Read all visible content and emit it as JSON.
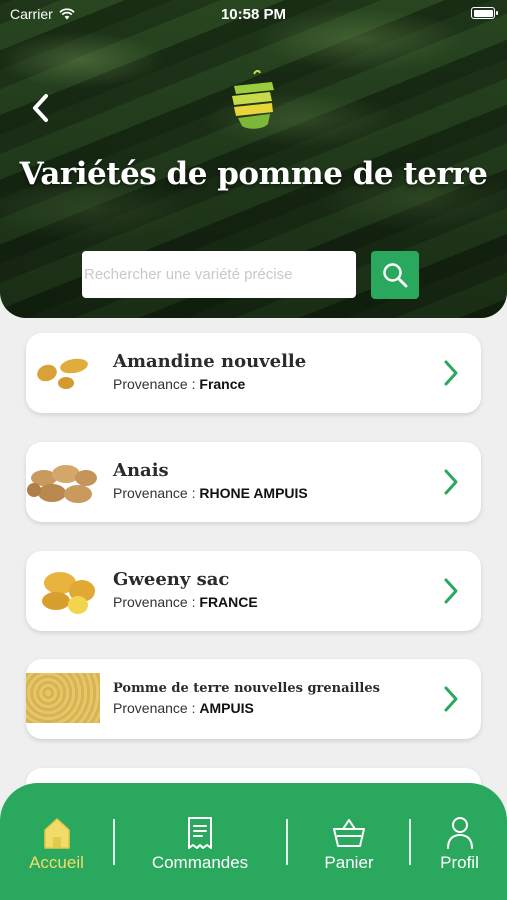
{
  "status_bar": {
    "carrier": "Carrier",
    "time": "10:58 PM"
  },
  "header": {
    "title": "Variétés de pomme de terre"
  },
  "search": {
    "placeholder": "Rechercher une variété précise"
  },
  "origin_label": "Provenance :",
  "items": [
    {
      "name": "Amandine nouvelle",
      "origin": "France"
    },
    {
      "name": "Anais",
      "origin": "RHONE AMPUIS"
    },
    {
      "name": "Gweeny sac",
      "origin": "FRANCE"
    },
    {
      "name": "Pomme de terre nouvelles grenailles",
      "origin": "AMPUIS"
    }
  ],
  "tabs": [
    {
      "label": "Accueil",
      "icon": "home-icon",
      "active": true
    },
    {
      "label": "Commandes",
      "icon": "receipt-icon",
      "active": false
    },
    {
      "label": "Panier",
      "icon": "basket-icon",
      "active": false
    },
    {
      "label": "Profil",
      "icon": "person-icon",
      "active": false
    }
  ],
  "colors": {
    "accent": "#2aa85d",
    "active_tab": "#f1dc6a",
    "background": "#efefef"
  }
}
